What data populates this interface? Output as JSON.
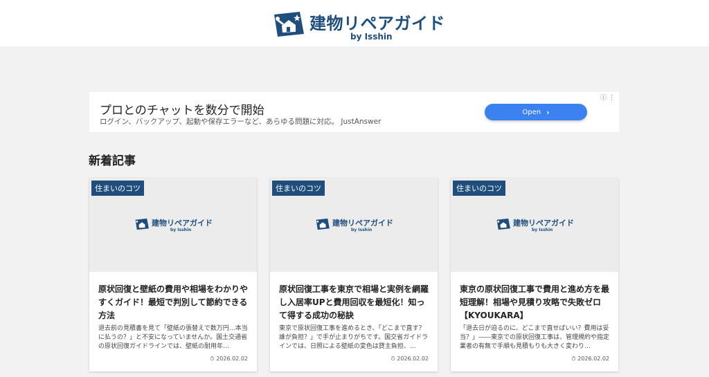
{
  "header": {
    "logo_title": "建物リペアガイド",
    "logo_subtitle": "by Isshin",
    "logo_icon": "house-repair-icon",
    "brand_color": "#1f4e7d"
  },
  "ad": {
    "title": "プロとのチャットを数分で開始",
    "description": "ログイン、バックアップ、起動や保存エラーなど、あらゆる問題に対応。 JustAnswer",
    "button_label": "Open",
    "button_icon": "chevron-right-icon",
    "info_text": "ⓘ ⋮",
    "button_color": "#3b82f0"
  },
  "section": {
    "title": "新着記事"
  },
  "cards": [
    {
      "category": "住まいのコツ",
      "thumb_title": "建物リペアガイド",
      "thumb_subtitle": "by Isshin",
      "title": "原状回復と壁紙の費用や相場をわかりやすくガイド！最短で判別して節約できる方法",
      "excerpt": "退去前の見積書を見て「壁紙の張替えで数万円…本当に払うの？」と不安になっていませんか。国土交通省の原状回復ガイドラインでは、壁紙の耐用年…",
      "date": "2026.02.02",
      "date_icon": "clock-icon"
    },
    {
      "category": "住まいのコツ",
      "thumb_title": "建物リペアガイド",
      "thumb_subtitle": "by Isshin",
      "title": "原状回復工事を東京で相場と実例を網羅し入居率UPと費用回収を最短化！知って得する成功の秘訣",
      "excerpt": "東京で原状回復工事を進めるとき、「どこまで直す？誰が負担？」で手が止まりがちです。国交省ガイドラインでは、日照による壁紙の変色は貸主負担、…",
      "date": "2026.02.02",
      "date_icon": "clock-icon"
    },
    {
      "category": "住まいのコツ",
      "thumb_title": "建物リペアガイド",
      "thumb_subtitle": "by Isshin",
      "title": "東京の原状回復工事で費用と進め方を最短理解！相場や見積り攻略で失敗ゼロ【KYOUKARA】",
      "excerpt": "「退去日が迫るのに、どこまで直せばいい？費用は妥当？」――東京での原状回復工事は、管理規約や指定業者の有無で手順も見積もりも大きく変わり…",
      "date": "2026.02.02",
      "date_icon": "clock-icon"
    }
  ]
}
